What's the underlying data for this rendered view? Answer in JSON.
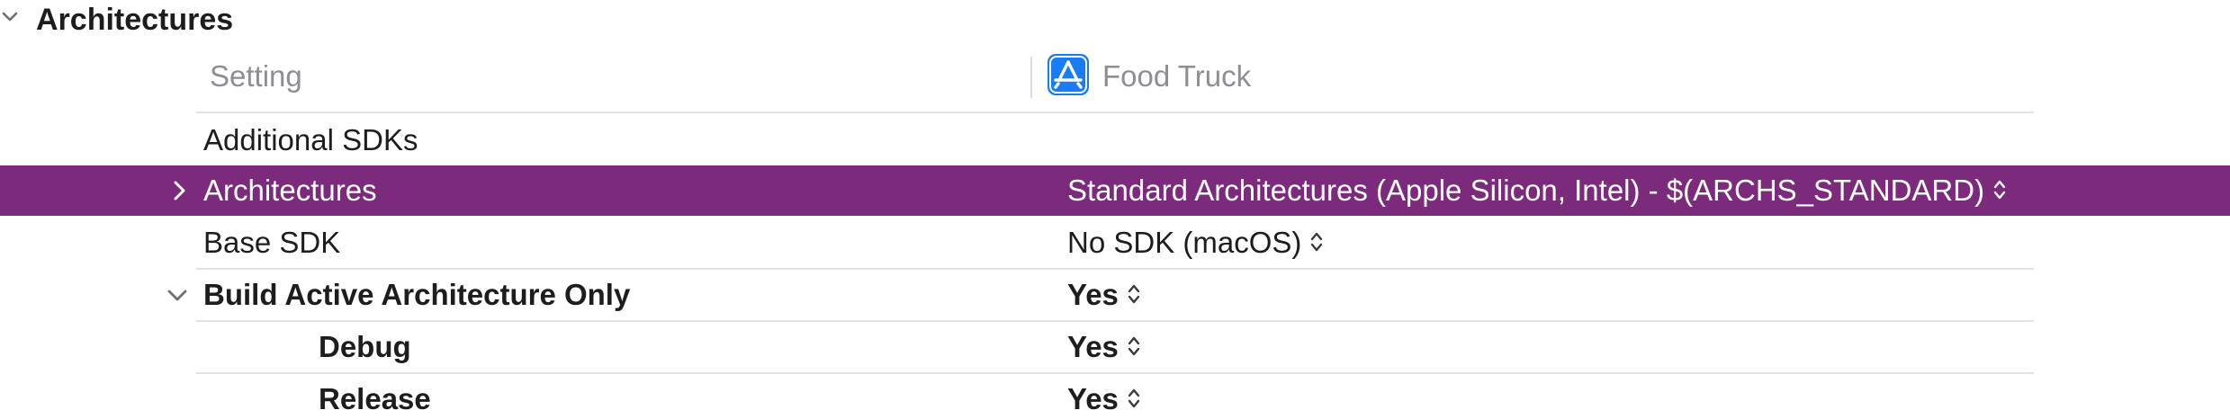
{
  "section": {
    "title": "Architectures",
    "chevron_icon": "chevron-down-icon"
  },
  "columns": {
    "setting": "Setting",
    "target": "Food Truck",
    "target_icon": "app-store-icon"
  },
  "rows": [
    {
      "label": "Additional SDKs",
      "value": "",
      "bold": false,
      "selected": false
    },
    {
      "label": "Architectures",
      "value": "Standard Architectures (Apple Silicon, Intel)  -  $(ARCHS_STANDARD)",
      "bold": false,
      "selected": true,
      "disclosure": "chevron-right-icon"
    },
    {
      "label": "Base SDK",
      "value": "No SDK (macOS)",
      "bold": false,
      "selected": false
    },
    {
      "label": "Build Active Architecture Only",
      "value": "Yes",
      "bold": true,
      "selected": false,
      "disclosure": "chevron-down-icon"
    },
    {
      "label": "Debug",
      "value": "Yes",
      "bold": true,
      "selected": false
    },
    {
      "label": "Release",
      "value": "Yes",
      "bold": true,
      "selected": false
    }
  ],
  "colors": {
    "selection": "#7c2a7c",
    "accent_icon": "#1a7cf5",
    "secondary_text": "#8e8e93"
  }
}
